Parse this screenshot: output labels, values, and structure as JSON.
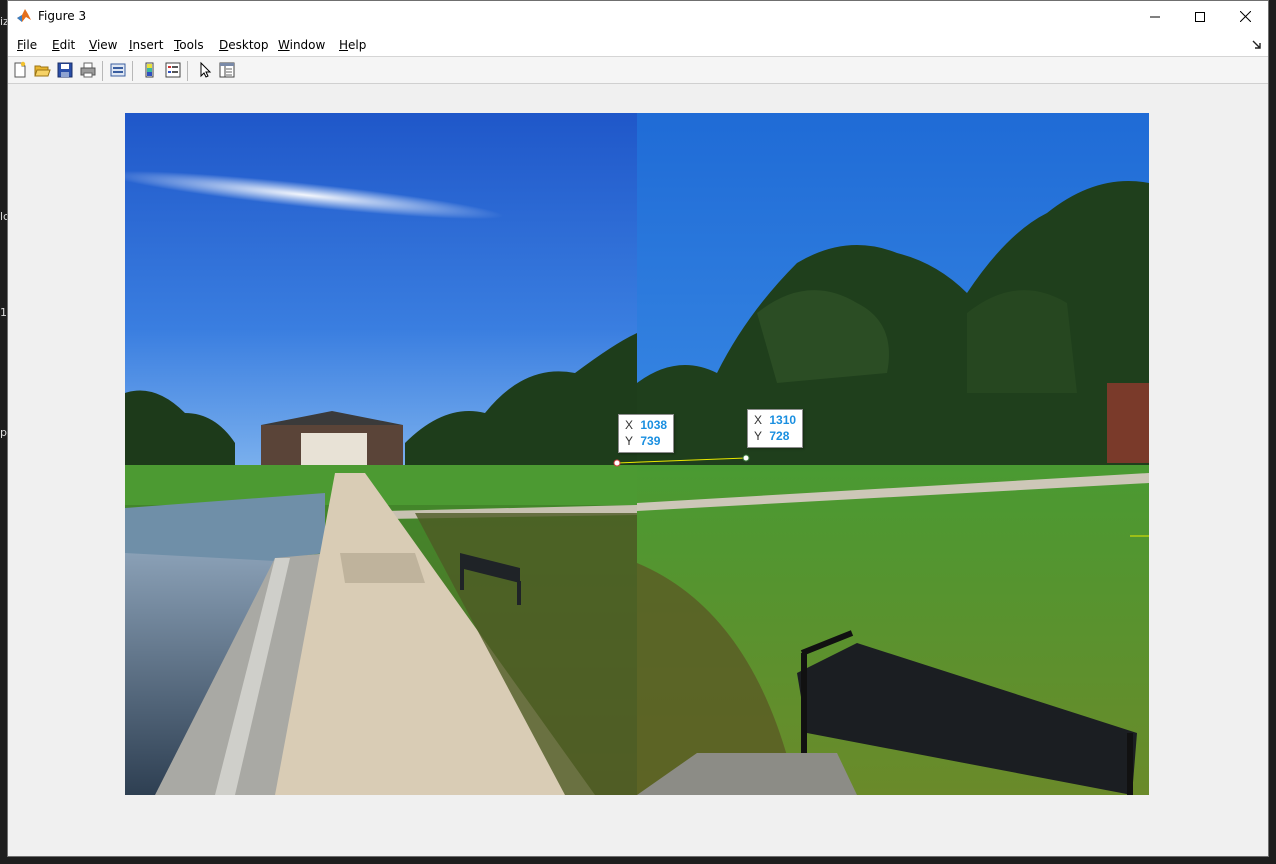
{
  "window": {
    "title": "Figure 3",
    "controls": {
      "minimize": "minimize",
      "maximize": "maximize",
      "close": "close"
    }
  },
  "menu": [
    {
      "label": "File",
      "mnemonic": "F",
      "rest": "ile"
    },
    {
      "label": "Edit",
      "mnemonic": "E",
      "rest": "dit"
    },
    {
      "label": "View",
      "mnemonic": "V",
      "rest": "iew"
    },
    {
      "label": "Insert",
      "mnemonic": "I",
      "rest": "nsert"
    },
    {
      "label": "Tools",
      "mnemonic": "T",
      "rest": "ools"
    },
    {
      "label": "Desktop",
      "mnemonic": "D",
      "rest": "esktop"
    },
    {
      "label": "Window",
      "mnemonic": "W",
      "rest": "indow"
    },
    {
      "label": "Help",
      "mnemonic": "H",
      "rest": "elp"
    }
  ],
  "toolbar": {
    "buttons": [
      "new-figure-icon",
      "open-file-icon",
      "save-icon",
      "print-icon",
      "print-preview-icon",
      "insert-colorbar-icon",
      "insert-legend-icon",
      "edit-plot-icon",
      "property-inspector-icon"
    ]
  },
  "figure": {
    "images": [
      "left-photo-fountain-walkway",
      "right-photo-lawn-bench"
    ],
    "datatips": [
      {
        "x_label": "X",
        "x_value": "1038",
        "y_label": "Y",
        "y_value": "739"
      },
      {
        "x_label": "X",
        "x_value": "1310",
        "y_label": "Y",
        "y_value": "728"
      }
    ],
    "colors": {
      "background": "#f0f0f0",
      "datatip_value": "#1a8fe0",
      "match_line": "#e8e800"
    }
  },
  "desktop_fragments": [
    "iz",
    "lc",
    "1",
    "p"
  ]
}
